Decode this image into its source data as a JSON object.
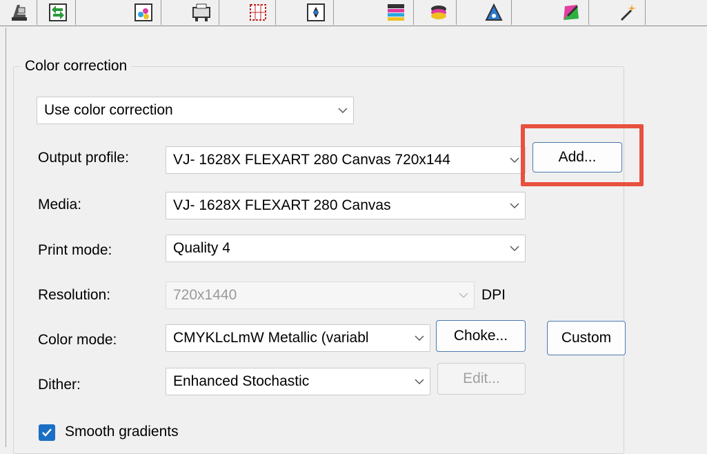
{
  "toolbar": {
    "tabs": [
      {
        "name": "printer-setup-icon"
      },
      {
        "name": "job-transfer-icon"
      },
      {
        "name": "color-ink-icon"
      },
      {
        "name": "printer-queue-icon"
      },
      {
        "name": "marks-grid-icon"
      },
      {
        "name": "layout-target-icon"
      },
      {
        "name": "color-bars-icon"
      },
      {
        "name": "ink-stack-icon"
      },
      {
        "name": "profile-triangle-icon"
      },
      {
        "name": "color-picker-icon"
      },
      {
        "name": "magic-wand-icon"
      }
    ]
  },
  "group": {
    "title": "Color correction",
    "correction_mode": "Use color correction"
  },
  "form": {
    "output_profile": {
      "label": "Output profile:",
      "value": "VJ- 1628X FLEXART 280 Canvas 720x144",
      "button": "Add..."
    },
    "media": {
      "label": "Media:",
      "value": "VJ- 1628X FLEXART 280 Canvas"
    },
    "print_mode": {
      "label": "Print mode:",
      "value": "Quality 4"
    },
    "resolution": {
      "label": "Resolution:",
      "value": "720x1440",
      "unit": "DPI"
    },
    "color_mode": {
      "label": "Color mode:",
      "value": "CMYKLcLmW Metallic (variabl",
      "choke_button": "Choke...",
      "custom_button": "Custom"
    },
    "dither": {
      "label": "Dither:",
      "value": "Enhanced Stochastic",
      "edit_button": "Edit..."
    },
    "smooth_gradients": {
      "label": "Smooth gradients",
      "checked": true
    }
  },
  "colors": {
    "highlight": "#e8513f",
    "checkbox": "#1a6fc4",
    "button_border": "#4a78b0"
  }
}
